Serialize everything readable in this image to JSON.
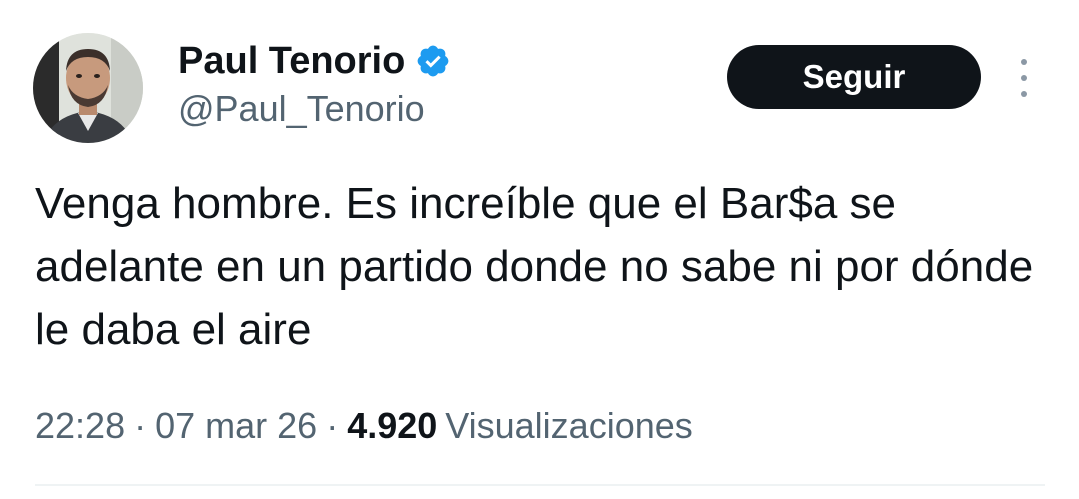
{
  "tweet": {
    "author": {
      "display_name": "Paul Tenorio",
      "handle": "@Paul_Tenorio",
      "verified": true,
      "verified_color": "#1d9bf0"
    },
    "follow_label": "Seguir",
    "more_icon": "more-vertical-icon",
    "text": "Venga hombre. Es increíble que el Bar$a se adelante en un partido donde no sabe ni por dónde le daba el aire",
    "time": "22:28",
    "date": "07 mar 26",
    "separator": "·",
    "views_count": "4.920",
    "views_label": "Visualizaciones"
  },
  "colors": {
    "primary_text": "#0f1419",
    "secondary_text": "#536471",
    "button_bg": "#0f1419",
    "button_text": "#ffffff",
    "divider": "#eff3f4"
  }
}
